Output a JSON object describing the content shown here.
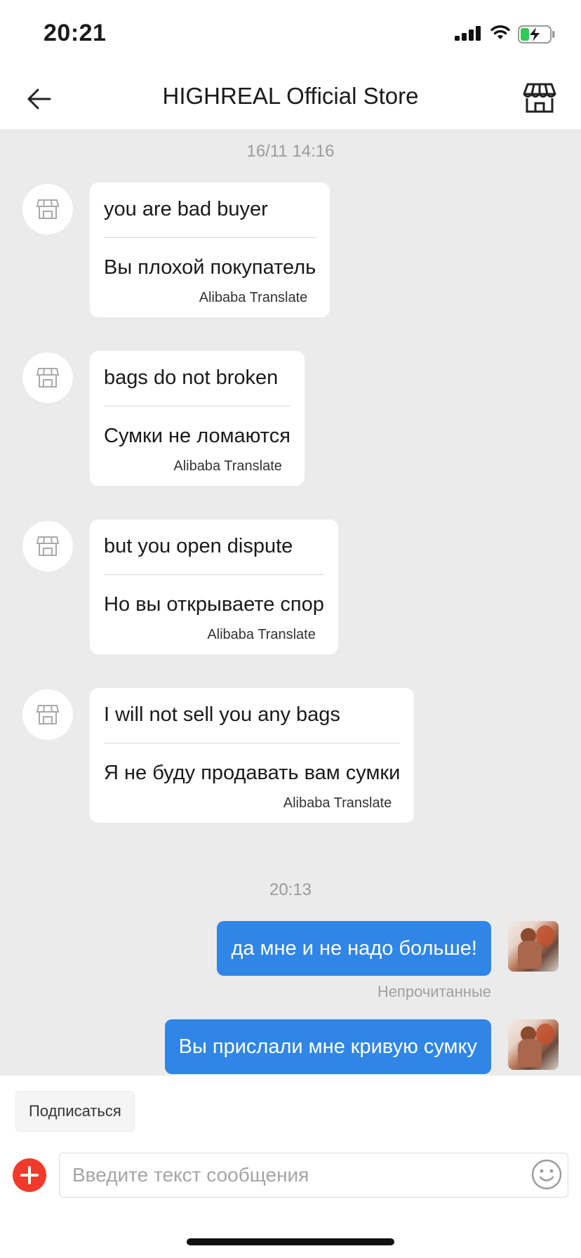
{
  "status_bar": {
    "time": "20:21"
  },
  "header": {
    "title": "HIGHREAL Official Store",
    "back_icon": "arrow-left-icon",
    "store_icon": "storefront-icon"
  },
  "chat": {
    "timestamps": [
      "16/11 14:16",
      "20:13"
    ],
    "incoming": [
      {
        "original": "you are bad buyer",
        "translation": "Вы плохой покупатель",
        "tag": "Alibaba Translate"
      },
      {
        "original": "bags do not broken",
        "translation": "Сумки не ломаются",
        "tag": "Alibaba Translate"
      },
      {
        "original": "but you open dispute",
        "translation": "Но вы открываете спор",
        "tag": "Alibaba Translate"
      },
      {
        "original": "I will not sell you any bags",
        "translation": "Я не буду продавать вам сумки",
        "tag": "Alibaba Translate"
      }
    ],
    "outgoing": [
      {
        "text": "да мне и не надо больше!"
      },
      {
        "text": "Вы прислали мне кривую сумку"
      }
    ],
    "unread_label": "Непрочитанные"
  },
  "bottom_bar": {
    "subscribe_label": "Подписаться",
    "input": {
      "placeholder": "Введите текст сообщения",
      "value": ""
    }
  },
  "colors": {
    "accent_blue": "#2f86e6",
    "plus_red": "#f13a2b",
    "chat_bg": "#ebebeb"
  }
}
